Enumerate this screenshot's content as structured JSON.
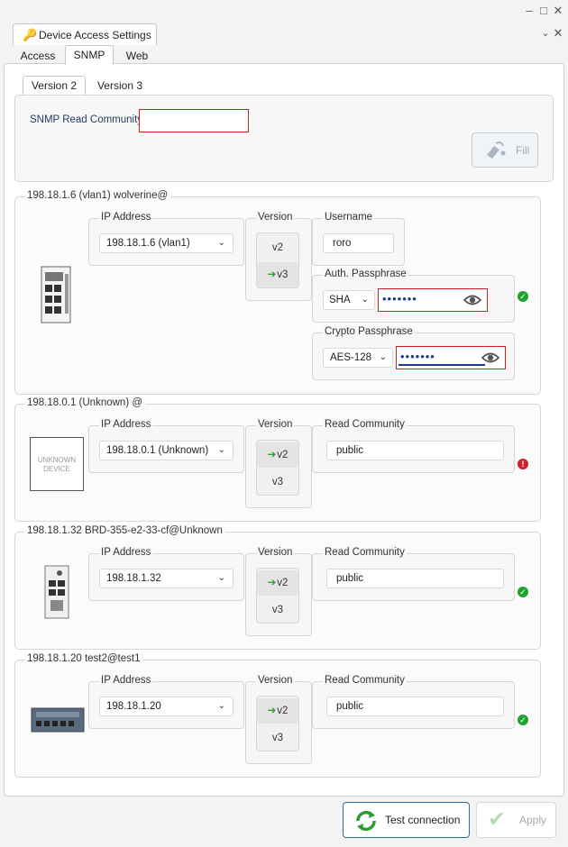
{
  "window": {
    "tab_title": "Device Access Settings"
  },
  "main_tabs": [
    "Access",
    "SNMP",
    "Web"
  ],
  "version_tabs": [
    "Version 2",
    "Version 3"
  ],
  "snmp": {
    "read_community_label": "SNMP Read Community",
    "read_community_value": "",
    "fill_label": "Fill"
  },
  "labels": {
    "ip_address": "IP Address",
    "version": "Version",
    "username": "Username",
    "auth_passphrase": "Auth. Passphrase",
    "crypto_passphrase": "Crypto Passphrase",
    "read_community": "Read Community",
    "v2": "v2",
    "v3": "v3",
    "unknown_device": "UNKNOWN DEVICE"
  },
  "devices": [
    {
      "title": "198.18.1.6 (vlan1) wolverine@",
      "ip": "198.18.1.6 (vlan1)",
      "version": "v3",
      "username": "roro",
      "auth_protocol": "SHA",
      "auth_passphrase": "•••••••",
      "crypto_protocol": "AES-128",
      "crypto_passphrase": "•••••••",
      "status": "ok"
    },
    {
      "title": "198.18.0.1 (Unknown) @",
      "ip": "198.18.0.1 (Unknown)",
      "version": "v2",
      "read_community": "public",
      "status": "error"
    },
    {
      "title": "198.18.1.32 BRD-355-e2-33-cf@Unknown",
      "ip": "198.18.1.32",
      "version": "v2",
      "read_community": "public",
      "status": "ok"
    },
    {
      "title": "198.18.1.20 test2@test1",
      "ip": "198.18.1.20",
      "version": "v2",
      "read_community": "public",
      "status": "ok"
    }
  ],
  "footer": {
    "test_connection": "Test connection",
    "apply": "Apply"
  },
  "colors": {
    "accent_green": "#2e9d2e",
    "error_red": "#d0202a",
    "password_blue": "#1e3a8a"
  }
}
